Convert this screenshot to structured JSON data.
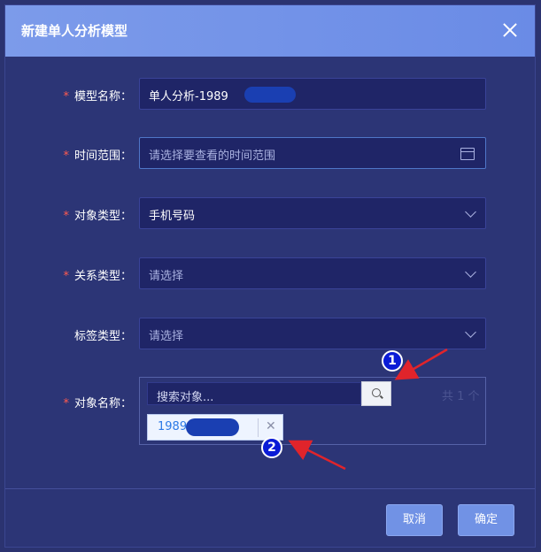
{
  "dialog": {
    "title": "新建单人分析模型",
    "close_icon": "close-icon"
  },
  "form": {
    "model_name": {
      "label": "模型名称：",
      "required": true,
      "value": "单人分析-1989"
    },
    "time_range": {
      "label": "时间范围：",
      "required": true,
      "placeholder": "请选择要查看的时间范围",
      "icon": "calendar-icon"
    },
    "object_type": {
      "label": "对象类型：",
      "required": true,
      "value": "手机号码"
    },
    "relation_type": {
      "label": "关系类型：",
      "required": true,
      "placeholder": "请选择"
    },
    "tag_type": {
      "label": "标签类型：",
      "required": false,
      "placeholder": "请选择"
    },
    "object_name": {
      "label": "对象名称：",
      "required": true,
      "search_placeholder": "搜索对象...",
      "count_text": "共 1 个",
      "tag_value": "1989"
    }
  },
  "footer": {
    "cancel_label": "取消",
    "confirm_label": "确定"
  },
  "annotations": {
    "marker1": "1",
    "marker2": "2"
  },
  "colors": {
    "header": "#6a8be6",
    "body": "#2c3576",
    "field_bg": "#1f2567",
    "required_star": "#ff5a4f",
    "arrow": "#e0242b",
    "button": "#7192e5"
  }
}
